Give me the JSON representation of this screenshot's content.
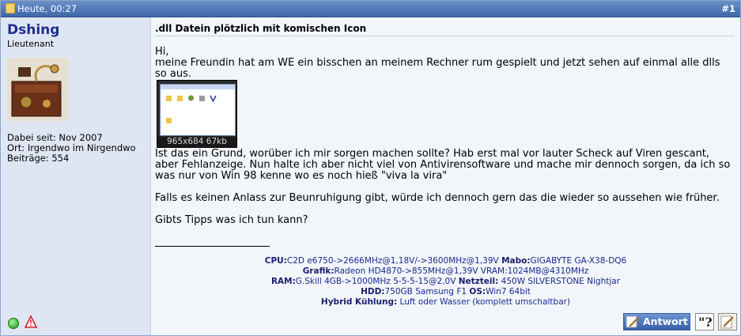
{
  "header": {
    "date": "Heute, 00:27",
    "post_number": "#1"
  },
  "user": {
    "name": "Dshing",
    "rank": "Lieutenant",
    "joined": "Dabei seit: Nov 2007",
    "location": "Ort: Irgendwo im Nirgendwo",
    "posts": "Beiträge: 554"
  },
  "post": {
    "title": ".dll Datein plötzlich mit komischen Icon",
    "line1": "Hi,",
    "line2": "meine Freundin hat am WE ein bisschen an meinem Rechner rum gespielt und jetzt sehen auf einmal alle dlls so aus.",
    "thumb_caption": "965x684  67kb",
    "para2": "Ist das ein Grund, worüber ich mir sorgen machen sollte? Hab erst mal vor lauter Scheck auf Viren gescant, aber Fehlanzeige. Nun halte ich aber nicht viel von Antivirensoftware und mache mir dennoch sorgen, da ich so was nur von Win 98 kenne wo es noch hieß \"viva la vira\"",
    "para3": "Falls es keinen Anlass zur Beunruhigung gibt, würde ich dennoch gern das die wieder so aussehen wie früher.",
    "para4": "Gibts Tipps was ich tun kann?"
  },
  "signature": {
    "cpu_label": "CPU:",
    "cpu": "C2D e6750->2666MHz@1,18V/->3600MHz@1,39V",
    "mobo_label": "Mabo:",
    "mobo": "GIGABYTE GA-X38-DQ6",
    "gpu_label": "Grafik:",
    "gpu": "Radeon HD4870->855MHz@1,39V VRAM:1024MB@4310MHz",
    "ram_label": "RAM:",
    "ram": "G.Skill 4GB->1000MHz 5-5-5-15@2,0V",
    "psu_label": "Netzteil:",
    "psu": "450W SILVERSTONE Nightjar",
    "hdd_label": "HDD:",
    "hdd": "750GB Samsung F1",
    "os_label": "OS:",
    "os": "Win7 64bit",
    "cool_label": "Hybrid Kühlung:",
    "cool": "Luft oder Wasser (komplett umschaltbar)"
  },
  "buttons": {
    "reply": "Antwort"
  },
  "icons": {
    "status": "online-status-icon",
    "report": "report-warning-icon",
    "quote": "quote-icon",
    "multiquote": "multiquote-icon"
  }
}
